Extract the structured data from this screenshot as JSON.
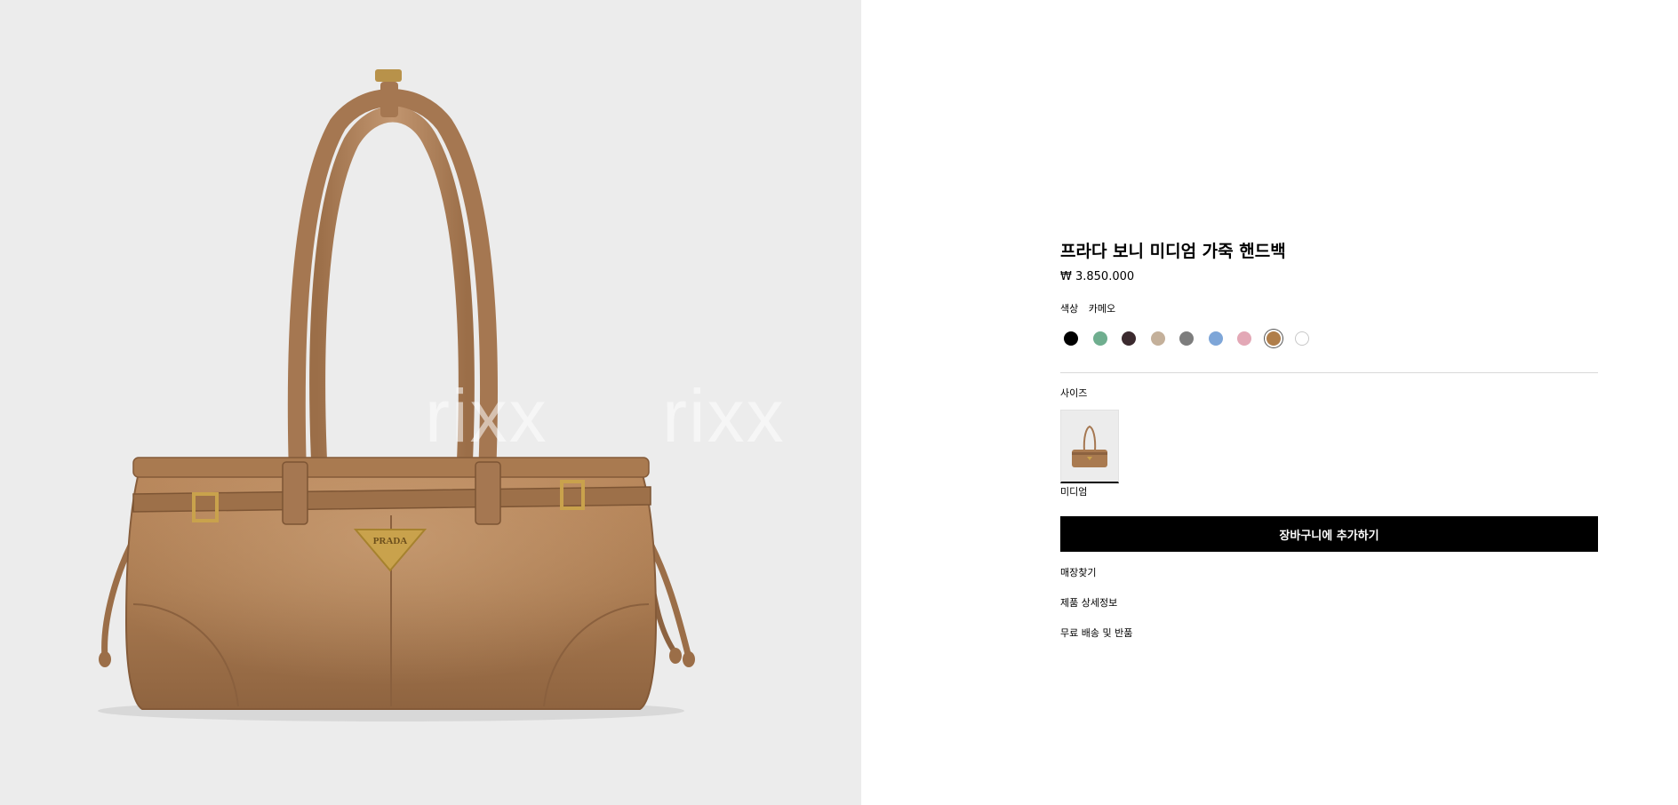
{
  "gallery": {
    "watermark": "rixx",
    "logo_text": "PRADA"
  },
  "product": {
    "title": "프라다 보니 미디엄 가죽 핸드백",
    "price": "₩ 3.850.000"
  },
  "color": {
    "label": "색상",
    "selected_value": "카메오",
    "swatches": [
      {
        "name": "black",
        "hex": "#000000"
      },
      {
        "name": "sage-green",
        "hex": "#6fae8f"
      },
      {
        "name": "dark-brown",
        "hex": "#3b2a2e"
      },
      {
        "name": "beige",
        "hex": "#c4b09a"
      },
      {
        "name": "grey",
        "hex": "#7d7d7d"
      },
      {
        "name": "blue",
        "hex": "#7ea6d8"
      },
      {
        "name": "pink",
        "hex": "#e3a8b6"
      },
      {
        "name": "cameo",
        "hex": "#b07e4a",
        "selected": true
      },
      {
        "name": "white",
        "hex": "#ffffff"
      }
    ]
  },
  "size": {
    "label": "사이즈",
    "options": [
      {
        "name": "미디엄",
        "selected": true
      }
    ]
  },
  "cart_button_label": "장바구니에 추가하기",
  "links": [
    "매장찾기",
    "제품 상세정보",
    "무료 배송 및 반품"
  ]
}
